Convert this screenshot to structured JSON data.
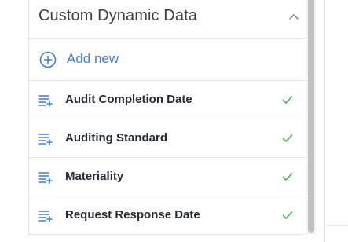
{
  "panel": {
    "title": "Custom Dynamic Data",
    "collapse_icon": "chevron-up-icon",
    "add_new": {
      "label": "Add new",
      "icon": "plus-circle-icon"
    },
    "items": [
      {
        "label": "Audit Completion Date",
        "icon": "list-add-icon",
        "status_icon": "check-icon"
      },
      {
        "label": "Auditing Standard",
        "icon": "list-add-icon",
        "status_icon": "check-icon"
      },
      {
        "label": "Materiality",
        "icon": "list-add-icon",
        "status_icon": "check-icon"
      },
      {
        "label": "Request Response Date",
        "icon": "list-add-icon",
        "status_icon": "check-icon"
      }
    ]
  },
  "colors": {
    "accent": "#3f7fd8",
    "success": "#5cb85c",
    "text": "#262a33",
    "border": "#e2e4e8"
  }
}
